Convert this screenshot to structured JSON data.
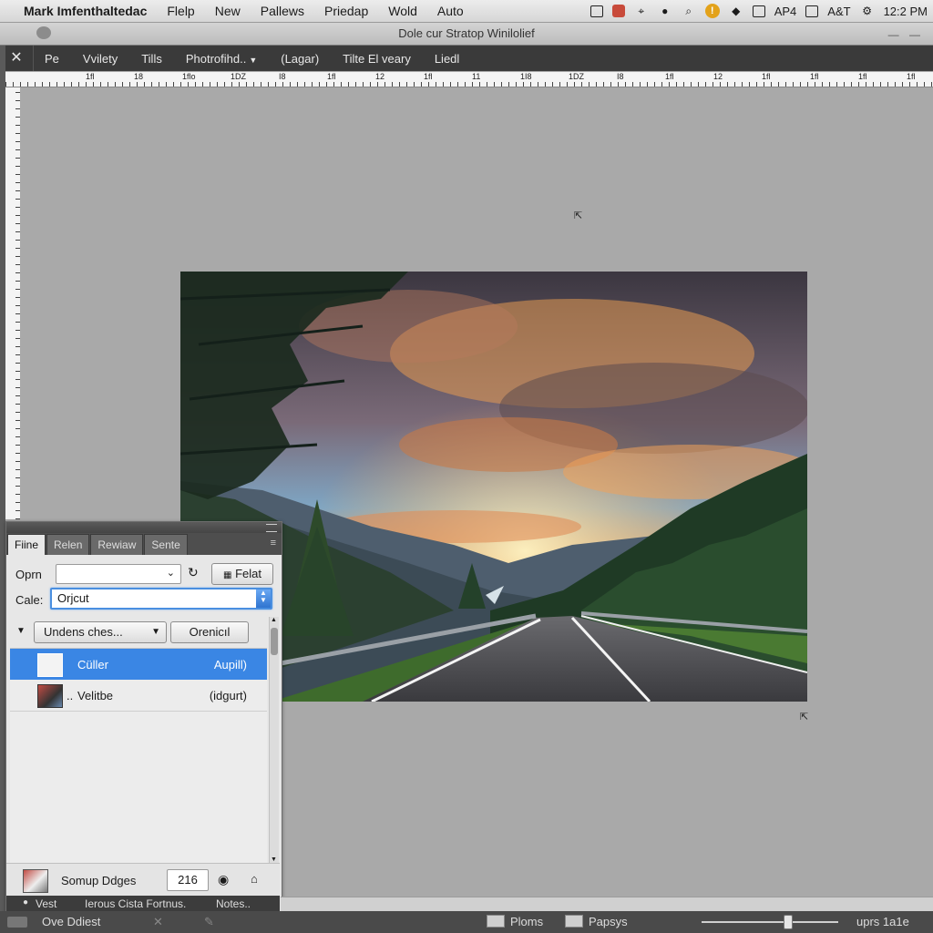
{
  "menubar": {
    "app_name": "Mark Imfenthaltedac",
    "items": [
      "Flelp",
      "New",
      "Pallews",
      "Priedap",
      "Wold",
      "Auto"
    ],
    "status_texts": [
      "AP4",
      "A&T"
    ],
    "clock": "12:2 PM"
  },
  "window": {
    "title": "Dole cur Stratop Winilolief",
    "controls": "— —"
  },
  "options_bar": {
    "close": "✕",
    "items": [
      "Pe",
      "Vvilety",
      "Tills",
      "Photrofihd..",
      "(Lagar)",
      "Tilte El veary",
      "Liedl"
    ]
  },
  "ruler": {
    "top_labels": [
      "1fl",
      "18",
      "1flo",
      "1Ǳ",
      "I8",
      "1fl",
      "12",
      "1fl",
      "11",
      "1I8",
      "1Ǳ",
      "I8",
      "1fl",
      "12",
      "1fl",
      "1fl",
      "1fl",
      "1fl"
    ]
  },
  "panel": {
    "tabs": [
      "Fiine",
      "Relen",
      "Rewiaw",
      "Sente"
    ],
    "tab_menu": "≡",
    "opm_label": "Oprn",
    "opm_value": "",
    "felat_button": "Felat",
    "cale_label": "Cale:",
    "cale_value": "Orjcut",
    "group_dropdown": "Undens ches...",
    "orenicl_button": "Orenicıl",
    "list": [
      {
        "name": "Cüller",
        "value": "Aupill)"
      },
      {
        "name": "Velitbe",
        "value": "(idgurt)"
      }
    ],
    "footer_label": "Somup Ddges",
    "footer_value": "216",
    "status_left": "Vest",
    "status_mid": "Ierous Cista Fortnus.",
    "status_right": "Notes.."
  },
  "statusbar": {
    "left_label": "Ove Ddiest",
    "toggle1": "Ploms",
    "toggle2": "Papsys",
    "right_label": "uprs 1a1e"
  }
}
